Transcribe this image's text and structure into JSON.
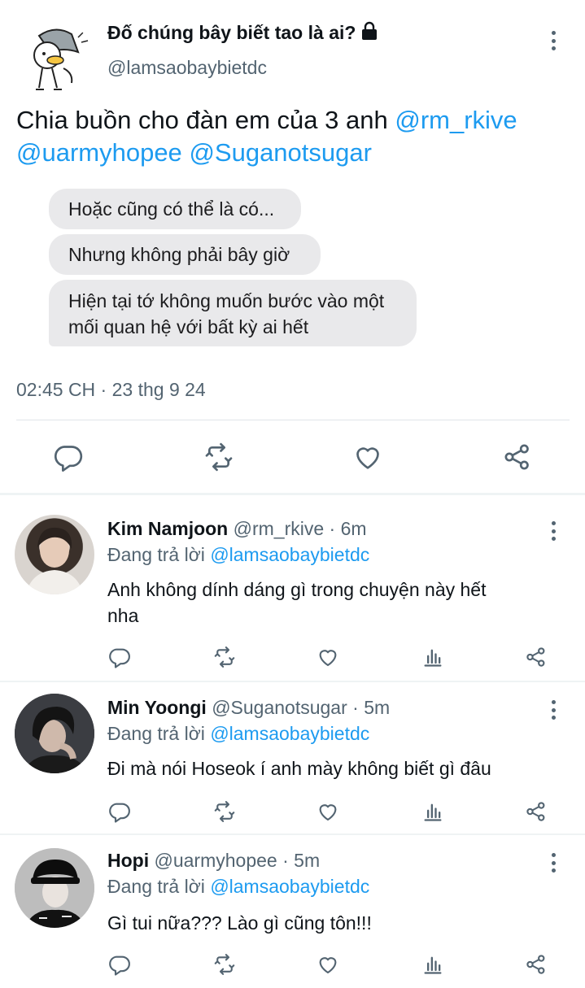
{
  "tweet": {
    "author_name": "Đố chúng bây biết tao là ai?",
    "author_handle": "@lamsaobaybietdc",
    "text_prefix": "Chia buồn cho đàn em của 3 anh ",
    "mentions": [
      "@rm_rkive",
      "@uarmyhopee",
      "@Suganotsugar"
    ],
    "image_bubbles": [
      "Hoặc cũng có thể là có...",
      "Nhưng không phải bây giờ",
      "Hiện tại tớ không muốn bước vào một",
      "mối quan hệ với bất kỳ ai hết"
    ],
    "timestamp": "02:45 CH · 23 thg 9 24",
    "actions": [
      "reply-icon",
      "retweet-icon",
      "like-icon",
      "share-icon"
    ]
  },
  "replies": [
    {
      "name": "Kim Namjoon",
      "handle": "@rm_rkive",
      "time": "· 6m",
      "replying_prefix": "Đang trả lời",
      "replying_to": "@lamsaobaybietdc",
      "text_lines": [
        "Anh không dính dáng gì trong chuyện này hết",
        "nha"
      ]
    },
    {
      "name": "Min Yoongi",
      "handle": "@Suganotsugar",
      "time": "· 5m",
      "replying_prefix": "Đang trả lời",
      "replying_to": "@lamsaobaybietdc",
      "text_lines": [
        "Đi mà nói Hoseok í anh mày không biết gì đâu"
      ]
    },
    {
      "name": "Hopi",
      "handle": "@uarmyhopee",
      "time": "· 5m",
      "replying_prefix": "Đang trả lời",
      "replying_to": "@lamsaobaybietdc",
      "text_lines": [
        "Gì tui nữa??? Lào gì cũng tôn!!!"
      ]
    }
  ],
  "colors": {
    "link": "#1d9bf0",
    "muted": "#536471",
    "divider": "#eff3f4",
    "bubble": "#e9e9eb"
  }
}
